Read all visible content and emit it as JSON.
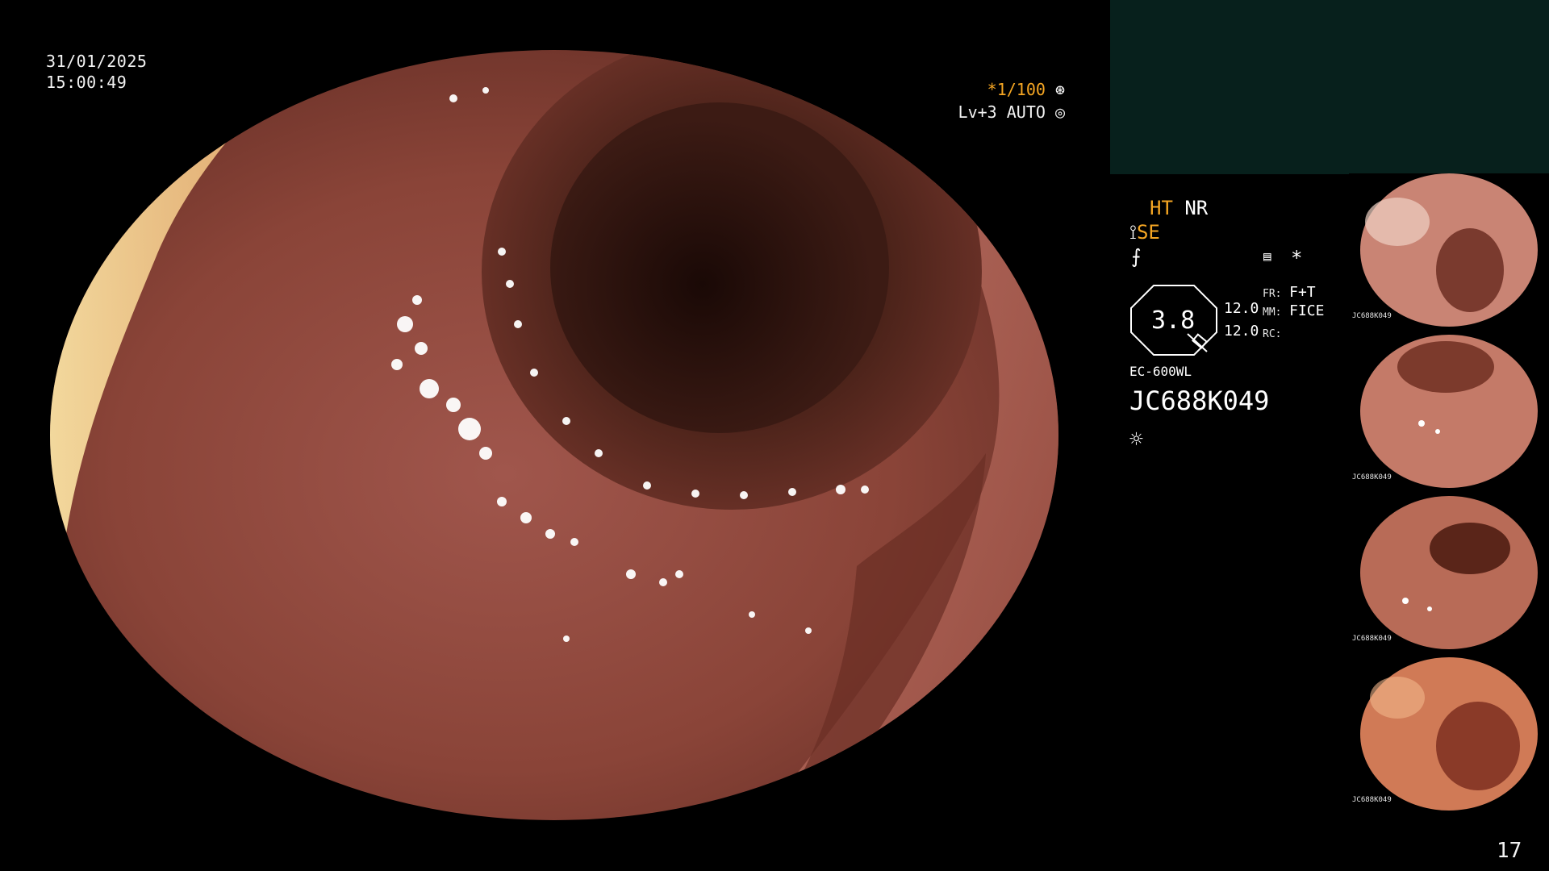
{
  "overlay": {
    "date": "31/01/2025",
    "time": "15:00:49",
    "shutter": "*1/100",
    "level": "Lv+3 AUTO"
  },
  "settings": {
    "ht": "HT",
    "nr": "NR",
    "se": "SE",
    "zoom": "3.8",
    "val1": "12.0",
    "val2": "12.0",
    "fr_label": "FR:",
    "fr_value": "F+T",
    "mm_label": "MM:",
    "mm_value": "FICE",
    "rc_label": "RC:",
    "asterisk": "*",
    "scope_model": "EC-600WL",
    "serial": "JC688K049"
  },
  "icons": {
    "shutter_icon": "aperture-icon",
    "auto_icon": "iris-icon",
    "light_icon": "light-source-icon",
    "structure_icon": "structure-enhancement-icon",
    "freeze_icon": "freeze-icon",
    "memory_icon": "memory-icon"
  },
  "colors": {
    "accent": "#f5a623",
    "panel": "#07201c"
  },
  "thumbnails": [
    {
      "caption": "JC688K049"
    },
    {
      "caption": "JC688K049"
    },
    {
      "caption": "JC688K049"
    },
    {
      "caption": "JC688K049"
    }
  ],
  "page_number": "17"
}
